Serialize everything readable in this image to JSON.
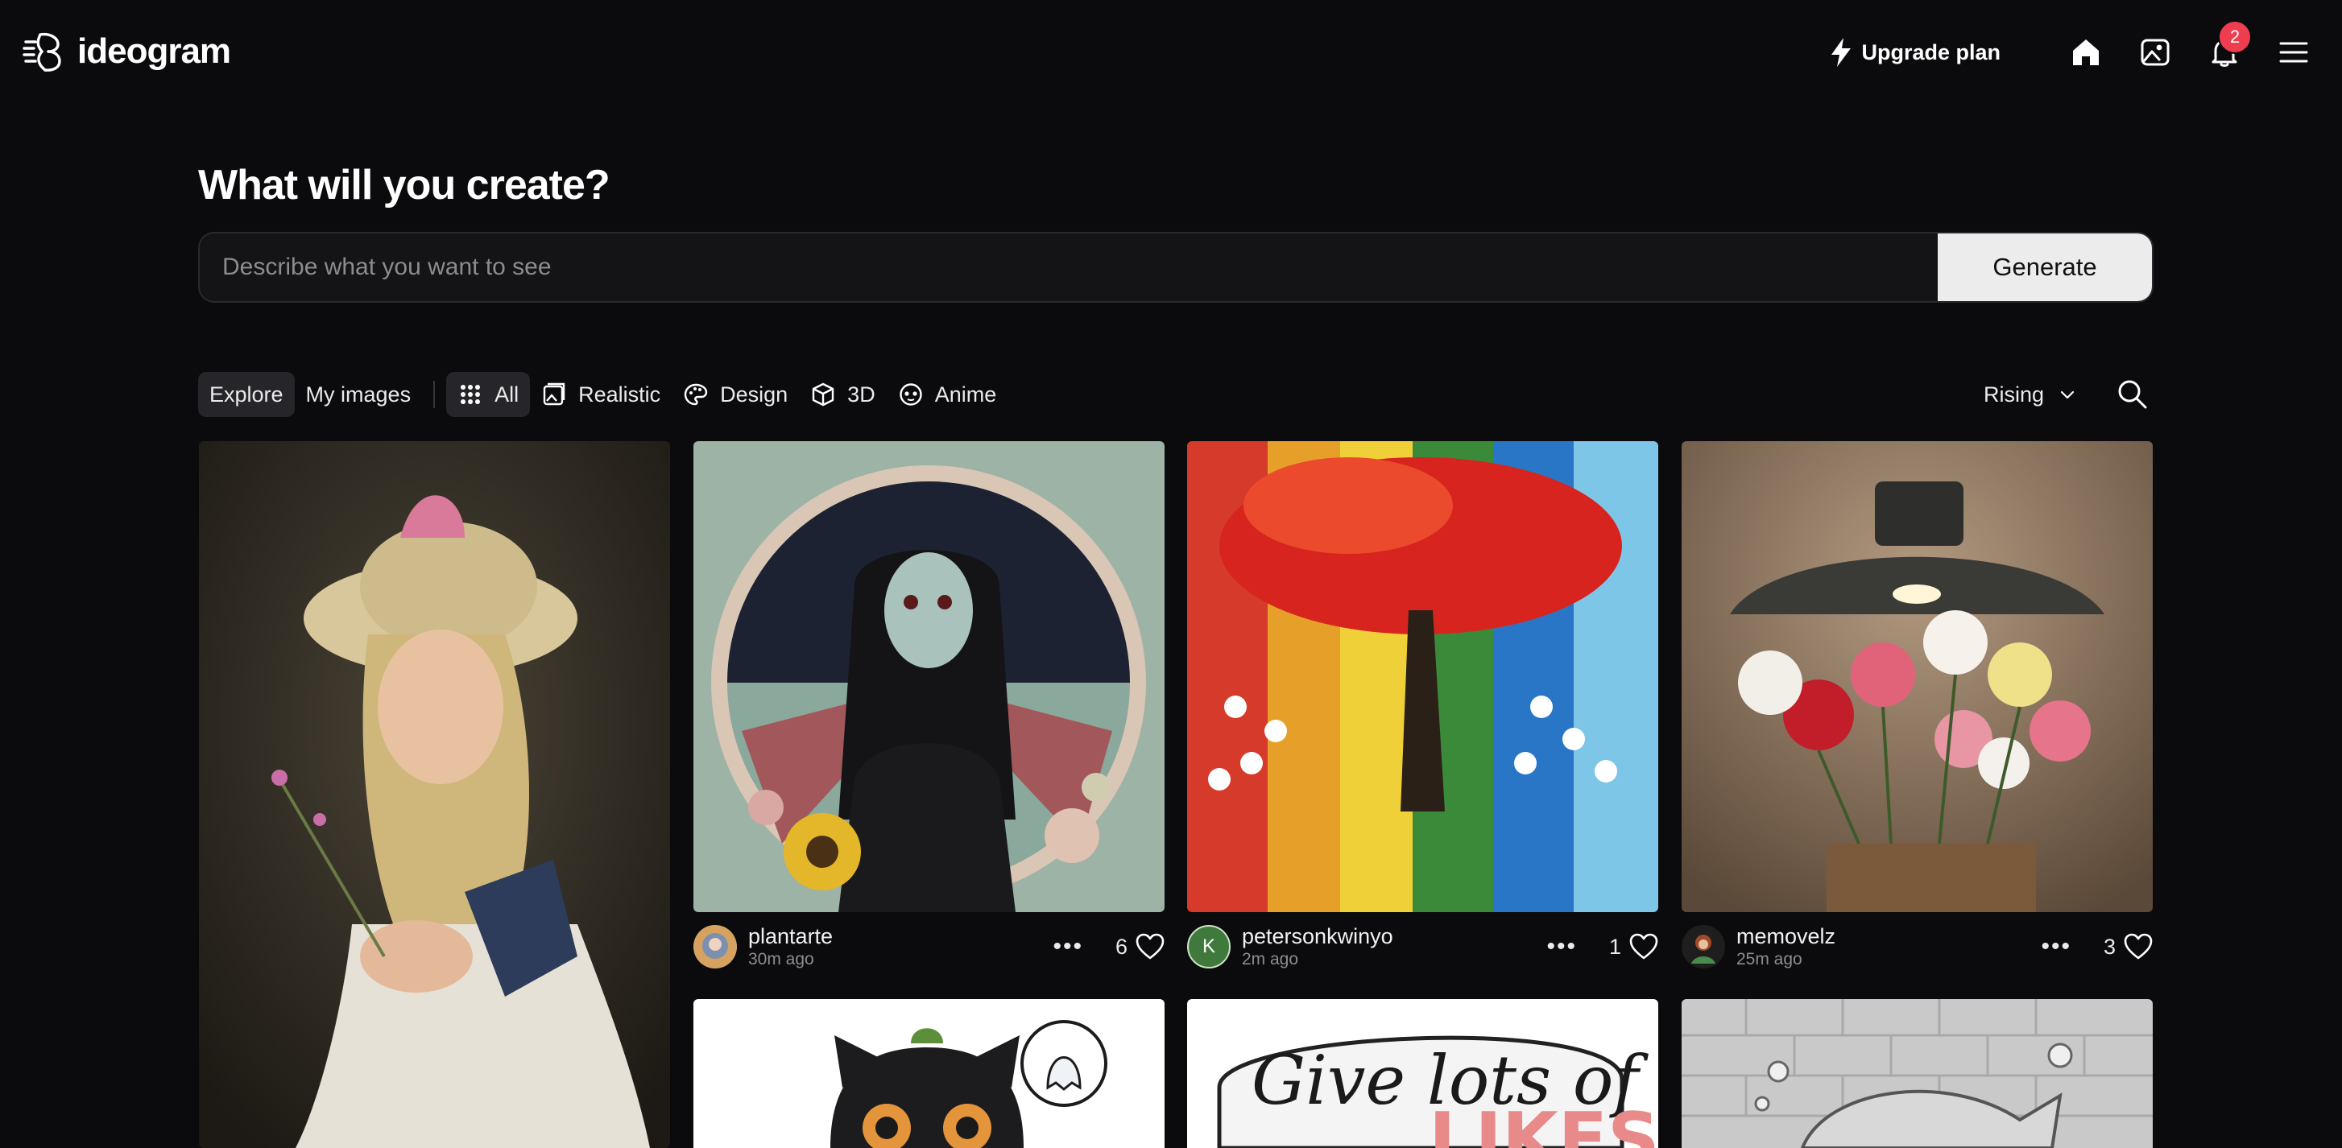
{
  "brand": {
    "name": "ideogram"
  },
  "header": {
    "upgrade_label": "Upgrade plan",
    "notification_count": "2"
  },
  "main": {
    "headline": "What will you create?",
    "prompt_placeholder": "Describe what you want to see",
    "generate_label": "Generate"
  },
  "filters": {
    "tabs": [
      {
        "label": "Explore",
        "active": true
      },
      {
        "label": "My images",
        "active": false
      }
    ],
    "categories": [
      {
        "label": "All",
        "icon": "grid-icon",
        "active": true
      },
      {
        "label": "Realistic",
        "icon": "photo-icon",
        "active": false
      },
      {
        "label": "Design",
        "icon": "palette-icon",
        "active": false
      },
      {
        "label": "3D",
        "icon": "cube-icon",
        "active": false
      },
      {
        "label": "Anime",
        "icon": "face-icon",
        "active": false
      }
    ],
    "sort_label": "Rising"
  },
  "cards": [
    {
      "image": "girl-in-straw-hat-painting"
    },
    {
      "image": "gothic-girl-with-flowers",
      "user": "plantarte",
      "time": "30m ago",
      "likes": "6"
    },
    {
      "image": "rainbow-tree-painting",
      "user": "petersonkwinyo",
      "avatar_letter": "K",
      "time": "2m ago",
      "likes": "1"
    },
    {
      "image": "lamp-with-carnations",
      "user": "memovelz",
      "time": "25m ago",
      "likes": "3"
    },
    {
      "image": "black-cat-with-ghost-sticker"
    },
    {
      "image": "give-lots-of-likes-sticker",
      "text_fragment": "Give lots of",
      "text_fragment_2": "LIKES"
    },
    {
      "image": "sketch-fish-brick-wall"
    }
  ],
  "colors": {
    "background": "#0b0b0d",
    "badge": "#ef3d50",
    "generate_button": "#ececec",
    "active_chip": "#26262a"
  }
}
